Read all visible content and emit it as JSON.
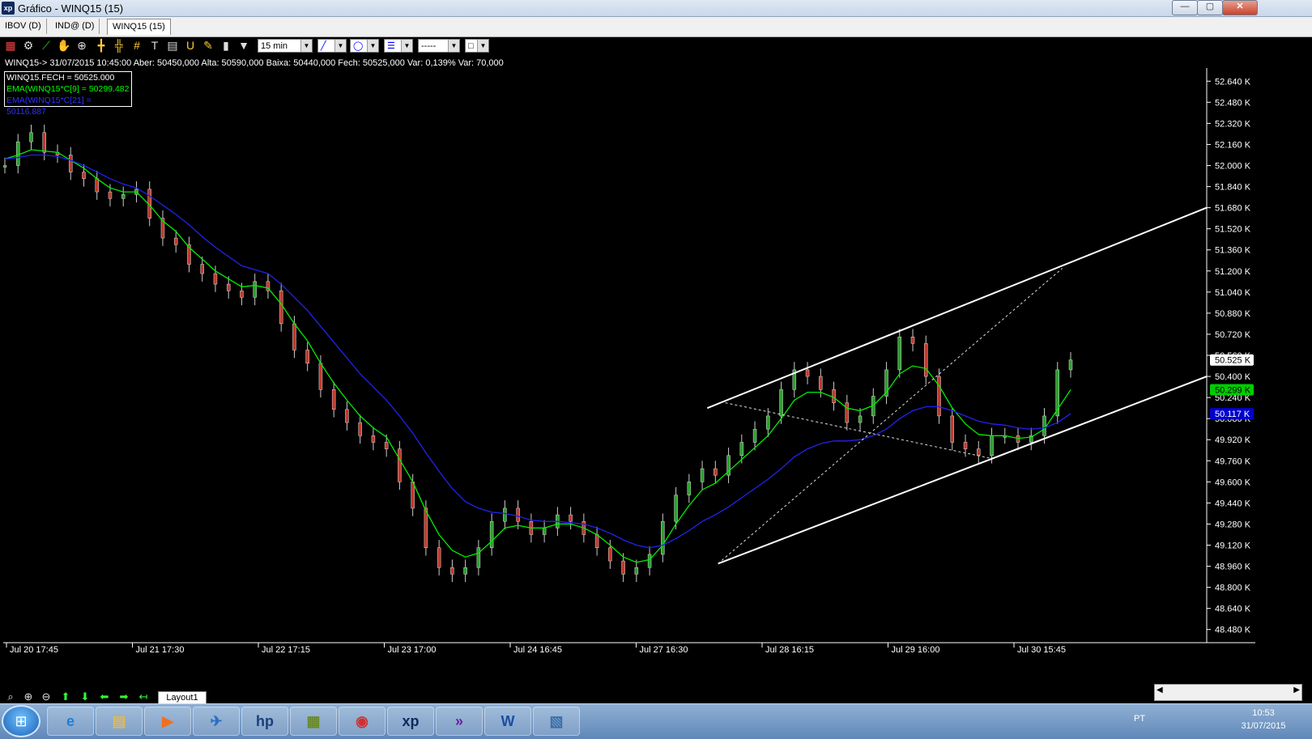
{
  "window": {
    "title": "Gráfico - WINQ15 (15)",
    "app_icon": "xp",
    "minimize": "—",
    "maximize": "▢",
    "close": "✕"
  },
  "tabs": [
    {
      "label": "IBOV (D)"
    },
    {
      "label": "IND@ (D)"
    },
    {
      "label": "WINQ15 (15)"
    }
  ],
  "toolbar": {
    "period": "15 min",
    "tool_icons": [
      "candle-chart-icon",
      "gear-icon",
      "trend-icon",
      "hand-icon",
      "zoom-icon",
      "crosshair-icon",
      "cursor-icon",
      "grid-icon",
      "text-tool-icon",
      "calculator-icon",
      "magnet-icon",
      "eraser-icon",
      "trash-icon",
      "filter-icon"
    ]
  },
  "info_line": "WINQ15-> 31/07/2015 10:45:00 Aber: 50450,000 Alta: 50590,000 Baixa: 50440,000 Fech: 50525,000 Var: 0,139% Var: 70,000",
  "legend": [
    {
      "text": "WINQ15.FECH = 50525.000",
      "color": "#ffffff"
    },
    {
      "text": "EMA(WINQ15*C[9] = 50299.482",
      "color": "#00ff00"
    },
    {
      "text": "EMA(WINQ15*C[21] = 50116.887",
      "color": "#3030ff"
    }
  ],
  "chart_data": {
    "type": "line",
    "instrument": "WINQ15",
    "y_ticks": [
      "52.640 K",
      "52.480 K",
      "52.320 K",
      "52.160 K",
      "52.000 K",
      "51.840 K",
      "51.680 K",
      "51.520 K",
      "51.360 K",
      "51.200 K",
      "51.040 K",
      "50.880 K",
      "50.720 K",
      "50.560 K",
      "50.400 K",
      "50.240 K",
      "50.080 K",
      "49.920 K",
      "49.760 K",
      "49.600 K",
      "49.440 K",
      "49.280 K",
      "49.120 K",
      "48.960 K",
      "48.800 K",
      "48.640 K",
      "48.480 K"
    ],
    "ylim": [
      48380,
      52740
    ],
    "x_ticks": [
      "Jul 20 17:45",
      "Jul 21 17:30",
      "Jul 22 17:15",
      "Jul 23 17:00",
      "Jul 24 16:45",
      "Jul 27 16:30",
      "Jul 28 16:15",
      "Jul 29 16:00",
      "Jul 30 15:45"
    ],
    "markers": [
      {
        "label": "50.525 K",
        "value": 50525,
        "bg": "#ffffff",
        "fg": "#000000"
      },
      {
        "label": "50.299 K",
        "value": 50299,
        "bg": "#00cc00",
        "fg": "#000000"
      },
      {
        "label": "50.117 K",
        "value": 50117,
        "bg": "#0000cc",
        "fg": "#ffffff"
      }
    ],
    "series": [
      {
        "name": "WINQ15.FECH",
        "color": "#ffffff",
        "values": [
          52000,
          52180,
          52250,
          52100,
          52080,
          51950,
          51900,
          51800,
          51750,
          51780,
          51820,
          51600,
          51450,
          51400,
          51250,
          51180,
          51100,
          51050,
          51000,
          51120,
          51050,
          50800,
          50600,
          50500,
          50300,
          50150,
          50050,
          49950,
          49900,
          49850,
          49600,
          49400,
          49100,
          48950,
          48900,
          48950,
          49100,
          49300,
          49400,
          49300,
          49200,
          49250,
          49350,
          49300,
          49200,
          49100,
          49000,
          48900,
          48950,
          49050,
          49300,
          49500,
          49600,
          49700,
          49650,
          49800,
          49900,
          50000,
          50100,
          50300,
          50450,
          50400,
          50300,
          50200,
          50050,
          50100,
          50250,
          50450,
          50700,
          50650,
          50400,
          50100,
          49900,
          49850,
          49800,
          49950,
          49950,
          49900,
          49950,
          50100,
          50450,
          50525
        ]
      },
      {
        "name": "EMA(WINQ15*C[9]",
        "color": "#00ee00",
        "values": [
          52050,
          52080,
          52120,
          52110,
          52100,
          52040,
          51980,
          51900,
          51830,
          51800,
          51800,
          51700,
          51580,
          51500,
          51380,
          51290,
          51200,
          51140,
          51080,
          51090,
          51070,
          50950,
          50800,
          50670,
          50500,
          50350,
          50220,
          50100,
          50010,
          49940,
          49770,
          49600,
          49380,
          49200,
          49080,
          49030,
          49060,
          49150,
          49250,
          49270,
          49250,
          49250,
          49280,
          49280,
          49250,
          49200,
          49120,
          49030,
          48990,
          49010,
          49120,
          49280,
          49420,
          49540,
          49590,
          49680,
          49770,
          49860,
          49950,
          50080,
          50220,
          50280,
          50280,
          50240,
          50160,
          50140,
          50180,
          50280,
          50420,
          50480,
          50460,
          50330,
          50160,
          50040,
          49960,
          49950,
          49950,
          49930,
          49940,
          50000,
          50150,
          50299
        ]
      },
      {
        "name": "EMA(WINQ15*C[21]",
        "color": "#2222ee",
        "values": [
          52050,
          52060,
          52080,
          52080,
          52070,
          52040,
          52000,
          51950,
          51900,
          51860,
          51830,
          51770,
          51700,
          51630,
          51550,
          51460,
          51380,
          51310,
          51240,
          51210,
          51180,
          51100,
          51000,
          50900,
          50780,
          50660,
          50540,
          50420,
          50320,
          50220,
          50100,
          49970,
          49820,
          49680,
          49550,
          49450,
          49400,
          49370,
          49360,
          49340,
          49310,
          49300,
          49300,
          49290,
          49280,
          49250,
          49210,
          49160,
          49120,
          49100,
          49120,
          49170,
          49230,
          49300,
          49350,
          49410,
          49480,
          49550,
          49620,
          49700,
          49790,
          49850,
          49890,
          49910,
          49910,
          49920,
          49950,
          50000,
          50080,
          50140,
          50170,
          50170,
          50140,
          50100,
          50060,
          50040,
          50030,
          50010,
          50000,
          50010,
          50050,
          50117
        ]
      }
    ],
    "channel": {
      "upper": [
        {
          "x": 0.585,
          "y": 50160
        },
        {
          "x": 1.0,
          "y": 51680
        }
      ],
      "lower": [
        {
          "x": 0.594,
          "y": 48980
        },
        {
          "x": 1.0,
          "y": 50400
        }
      ]
    }
  },
  "bottom": {
    "layout_tab": "Layout1",
    "nav_icons": [
      "search-icon",
      "zoom-in-icon",
      "zoom-out-icon",
      "arrow-up-icon",
      "arrow-down-icon",
      "arrow-left-icon",
      "arrow-right-icon",
      "return-icon"
    ]
  },
  "taskbar": {
    "start": "⊞",
    "apps": [
      {
        "name": "internet-explorer-icon",
        "glyph": "e"
      },
      {
        "name": "file-explorer-icon",
        "glyph": "▤"
      },
      {
        "name": "media-player-icon",
        "glyph": "▶"
      },
      {
        "name": "mail-icon",
        "glyph": "✈"
      },
      {
        "name": "hp-icon",
        "glyph": "hp"
      },
      {
        "name": "calculator-app-icon",
        "glyph": "▦"
      },
      {
        "name": "chrome-icon",
        "glyph": "◉"
      },
      {
        "name": "xp-app-icon",
        "glyph": "xp"
      },
      {
        "name": "forward-app-icon",
        "glyph": "»"
      },
      {
        "name": "word-icon",
        "glyph": "W"
      },
      {
        "name": "image-app-icon",
        "glyph": "▧"
      }
    ],
    "lang": "PT",
    "time": "10:53",
    "date": "31/07/2015"
  }
}
